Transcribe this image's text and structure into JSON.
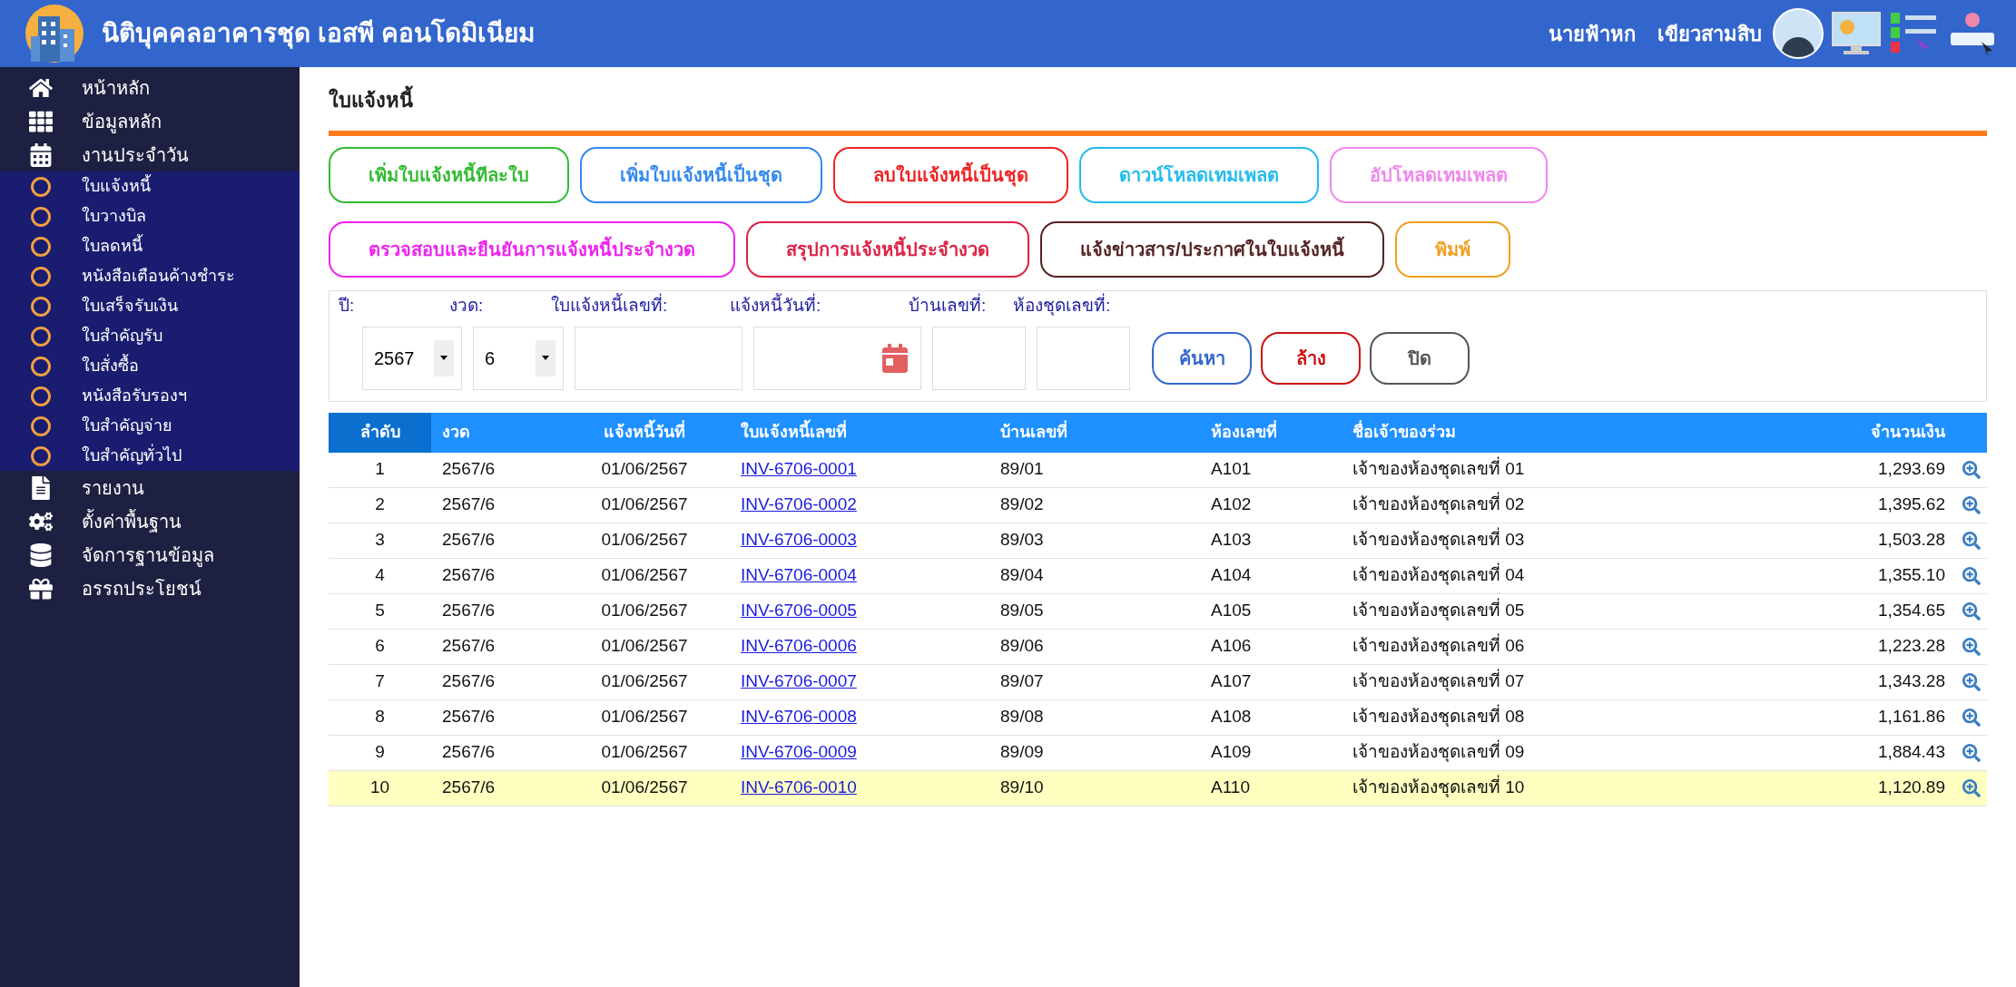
{
  "header": {
    "title": "นิติบุคคลอาคารชุด เอสพี คอนโดมิเนียม",
    "user_first": "นายฟ้าหก",
    "user_last": "เขียวสามสิบ"
  },
  "sidebar": {
    "items": [
      {
        "label": "หน้าหลัก",
        "kind": "home"
      },
      {
        "label": "ข้อมูลหลัก",
        "kind": "grid"
      },
      {
        "label": "งานประจำวัน",
        "kind": "calendar",
        "expanded": true,
        "children": [
          {
            "label": "ใบแจ้งหนี้"
          },
          {
            "label": "ใบวางบิล"
          },
          {
            "label": "ใบลดหนี้"
          },
          {
            "label": "หนังสือเตือนค้างชำระ"
          },
          {
            "label": "ใบเสร็จรับเงิน"
          },
          {
            "label": "ใบสำคัญรับ"
          },
          {
            "label": "ใบสั่งซื้อ"
          },
          {
            "label": "หนังสือรับรองฯ"
          },
          {
            "label": "ใบสำคัญจ่าย"
          },
          {
            "label": "ใบสำคัญทั่วไป"
          }
        ]
      },
      {
        "label": "รายงาน",
        "kind": "report"
      },
      {
        "label": "ตั้งค่าพื้นฐาน",
        "kind": "gears"
      },
      {
        "label": "จัดการฐานข้อมูล",
        "kind": "database"
      },
      {
        "label": "อรรถประโยชน์",
        "kind": "gift"
      }
    ]
  },
  "page_title": "ใบแจ้งหนี้",
  "action_rows": [
    [
      {
        "label": "เพิ่มใบแจ้งหนี้ทีละใบ",
        "color": "#33bb33"
      },
      {
        "label": "เพิ่มใบแจ้งหนี้เป็นชุด",
        "color": "#3388ee"
      },
      {
        "label": "ลบใบแจ้งหนี้เป็นชุด",
        "color": "#ee2222"
      },
      {
        "label": "ดาวน์โหลดเทมเพลต",
        "color": "#22bbee"
      },
      {
        "label": "อัปโหลดเทมเพลต",
        "color": "#ee88ee"
      }
    ],
    [
      {
        "label": "ตรวจสอบและยืนยันการแจ้งหนี้ประจำงวด",
        "color": "#ee22ee"
      },
      {
        "label": "สรุปการแจ้งหนี้ประจำงวด",
        "color": "#dd2244"
      },
      {
        "label": "แจ้งข่าวสาร/ประกาศในใบแจ้งหนี้",
        "color": "#552222"
      },
      {
        "label": "พิมพ์",
        "color": "#f0a020"
      }
    ]
  ],
  "filters": [
    {
      "label": "ปี:",
      "kind": "select",
      "value": "2567"
    },
    {
      "label": "งวด:",
      "kind": "select",
      "value": "6"
    },
    {
      "label": "ใบแจ้งหนี้เลขที่:",
      "kind": "text"
    },
    {
      "label": "แจ้งหนี้วันที่:",
      "kind": "date"
    },
    {
      "label": "บ้านเลขที่:",
      "kind": "text"
    },
    {
      "label": "ห้องชุดเลขที่:",
      "kind": "text"
    }
  ],
  "filter_buttons": [
    {
      "label": "ค้นหา",
      "color": "#3366cc"
    },
    {
      "label": "ล้าง",
      "color": "#cc1111"
    },
    {
      "label": "ปิด",
      "color": "#555555"
    }
  ],
  "table": {
    "columns": [
      {
        "label": "ลำดับ",
        "sorted": true
      },
      {
        "label": "งวด",
        "sorted": false
      },
      {
        "label": "แจ้งหนี้วันที่",
        "sorted": false
      },
      {
        "label": "ใบแจ้งหนี้เลขที่",
        "sorted": false
      },
      {
        "label": "บ้านเลขที่",
        "sorted": false
      },
      {
        "label": "ห้องเลขที่",
        "sorted": false
      },
      {
        "label": "ชื่อเจ้าของร่วม",
        "sorted": false
      },
      {
        "label": "จำนวนเงิน",
        "sorted": false
      }
    ],
    "rows": [
      {
        "cells": [
          "1",
          "2567/6",
          "01/06/2567",
          "INV-6706-0001",
          "89/01",
          "A101",
          "เจ้าของห้องชุดเลขที่ 01",
          "1,293.69"
        ],
        "selected": false
      },
      {
        "cells": [
          "2",
          "2567/6",
          "01/06/2567",
          "INV-6706-0002",
          "89/02",
          "A102",
          "เจ้าของห้องชุดเลขที่ 02",
          "1,395.62"
        ],
        "selected": false
      },
      {
        "cells": [
          "3",
          "2567/6",
          "01/06/2567",
          "INV-6706-0003",
          "89/03",
          "A103",
          "เจ้าของห้องชุดเลขที่ 03",
          "1,503.28"
        ],
        "selected": false
      },
      {
        "cells": [
          "4",
          "2567/6",
          "01/06/2567",
          "INV-6706-0004",
          "89/04",
          "A104",
          "เจ้าของห้องชุดเลขที่ 04",
          "1,355.10"
        ],
        "selected": false
      },
      {
        "cells": [
          "5",
          "2567/6",
          "01/06/2567",
          "INV-6706-0005",
          "89/05",
          "A105",
          "เจ้าของห้องชุดเลขที่ 05",
          "1,354.65"
        ],
        "selected": false
      },
      {
        "cells": [
          "6",
          "2567/6",
          "01/06/2567",
          "INV-6706-0006",
          "89/06",
          "A106",
          "เจ้าของห้องชุดเลขที่ 06",
          "1,223.28"
        ],
        "selected": false
      },
      {
        "cells": [
          "7",
          "2567/6",
          "01/06/2567",
          "INV-6706-0007",
          "89/07",
          "A107",
          "เจ้าของห้องชุดเลขที่ 07",
          "1,343.28"
        ],
        "selected": false
      },
      {
        "cells": [
          "8",
          "2567/6",
          "01/06/2567",
          "INV-6706-0008",
          "89/08",
          "A108",
          "เจ้าของห้องชุดเลขที่ 08",
          "1,161.86"
        ],
        "selected": false
      },
      {
        "cells": [
          "9",
          "2567/6",
          "01/06/2567",
          "INV-6706-0009",
          "89/09",
          "A109",
          "เจ้าของห้องชุดเลขที่ 09",
          "1,884.43"
        ],
        "selected": false
      },
      {
        "cells": [
          "10",
          "2567/6",
          "01/06/2567",
          "INV-6706-0010",
          "89/10",
          "A110",
          "เจ้าของห้องชุดเลขที่ 10",
          "1,120.89"
        ],
        "selected": true
      }
    ]
  }
}
